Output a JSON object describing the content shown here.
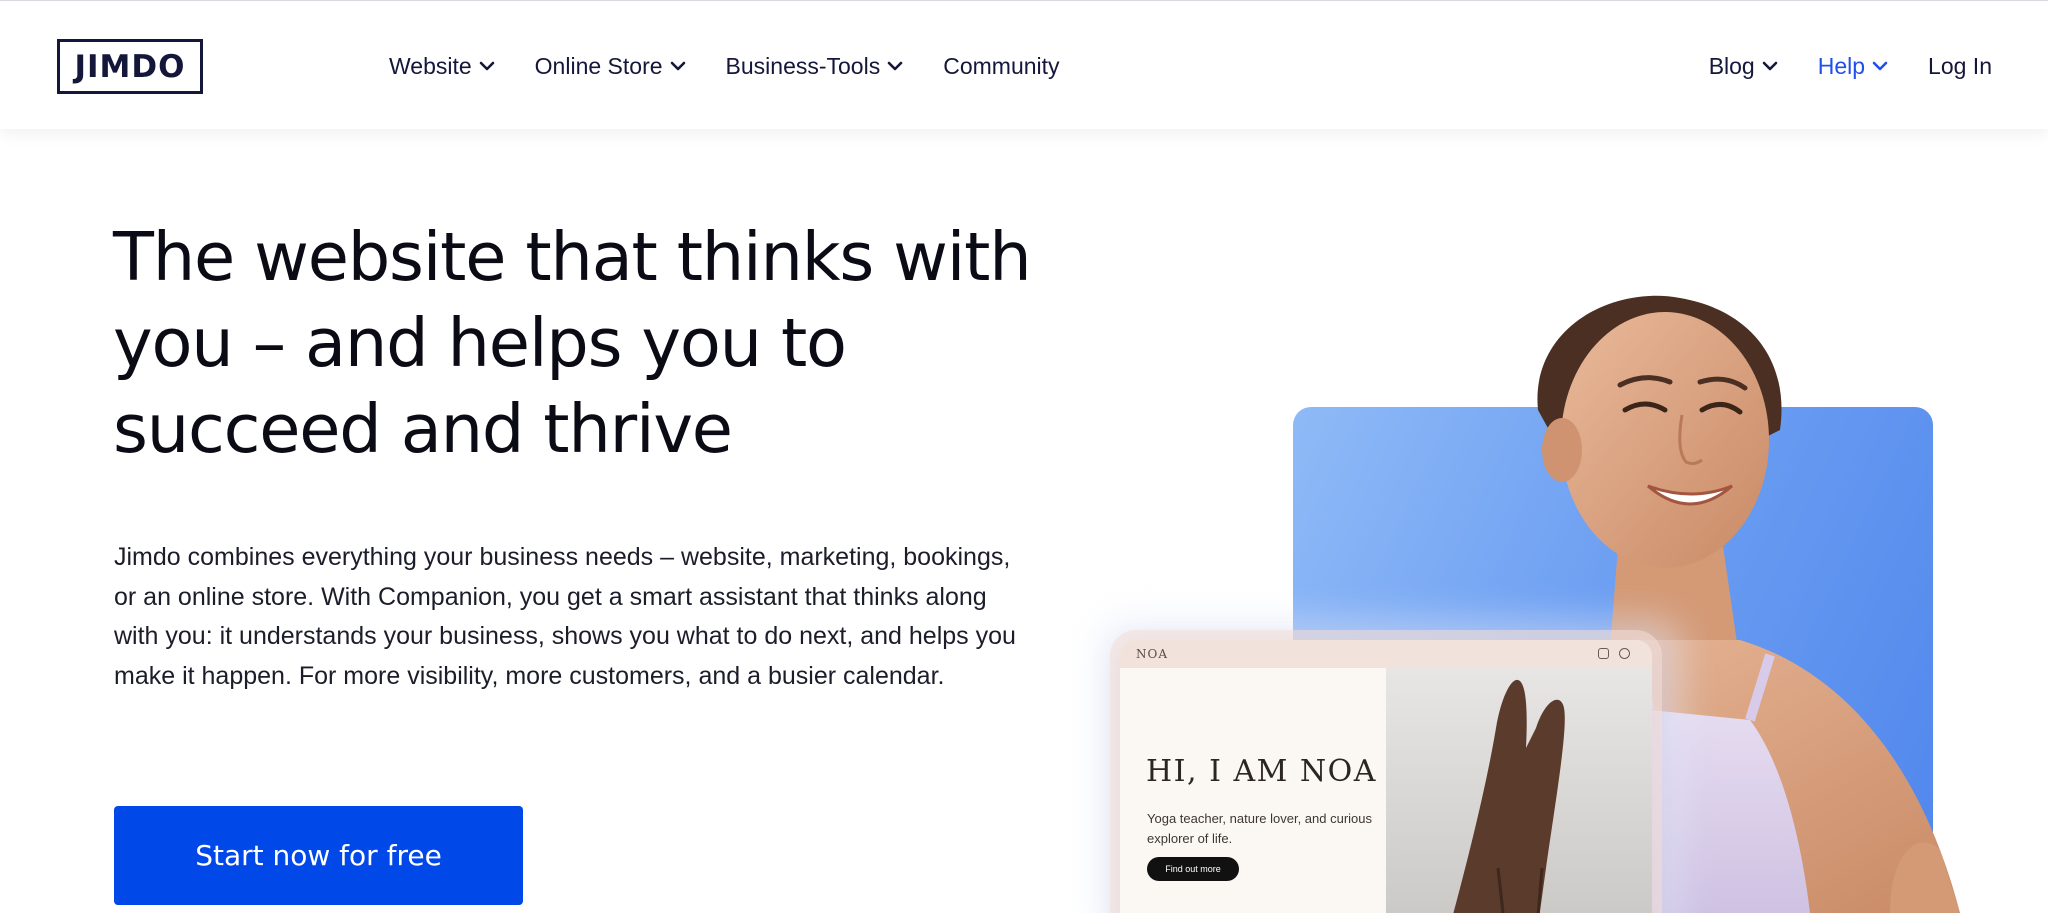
{
  "header": {
    "logo_text": "JIMDO",
    "nav_left": [
      {
        "label": "Website",
        "has_dropdown": true
      },
      {
        "label": "Online Store",
        "has_dropdown": true
      },
      {
        "label": "Business-Tools",
        "has_dropdown": true
      },
      {
        "label": "Community",
        "has_dropdown": false
      }
    ],
    "nav_right": [
      {
        "label": "Blog",
        "has_dropdown": true
      },
      {
        "label": "Help",
        "has_dropdown": true,
        "active": true
      },
      {
        "label": "Log In",
        "has_dropdown": false
      }
    ],
    "icons": {
      "dropdown": "chevron-down-icon"
    }
  },
  "hero": {
    "headline": "The website that thinks with you – and helps you to succeed and thrive",
    "lead": "Jimdo combines everything your business needs – website, marketing, bookings, or an online store. With Companion, you get a smart assistant that thinks along with you: it understands your business, shows you what to do next, and helps you make it happen. For more visibility, more customers, and a busier calendar.",
    "cta_label": "Start now for free"
  },
  "mockup": {
    "brand": "NOA",
    "title": "HI, I AM NOA",
    "subtitle": "Yoga teacher, nature lover, and curious explorer of life.",
    "button_label": "Find out more",
    "icons": [
      "instagram-icon",
      "whatsapp-icon"
    ]
  },
  "colors": {
    "accent": "#0048e8",
    "active_nav": "#2150e8",
    "text": "#0b0b15",
    "card_blue": "#6d9ff2"
  }
}
